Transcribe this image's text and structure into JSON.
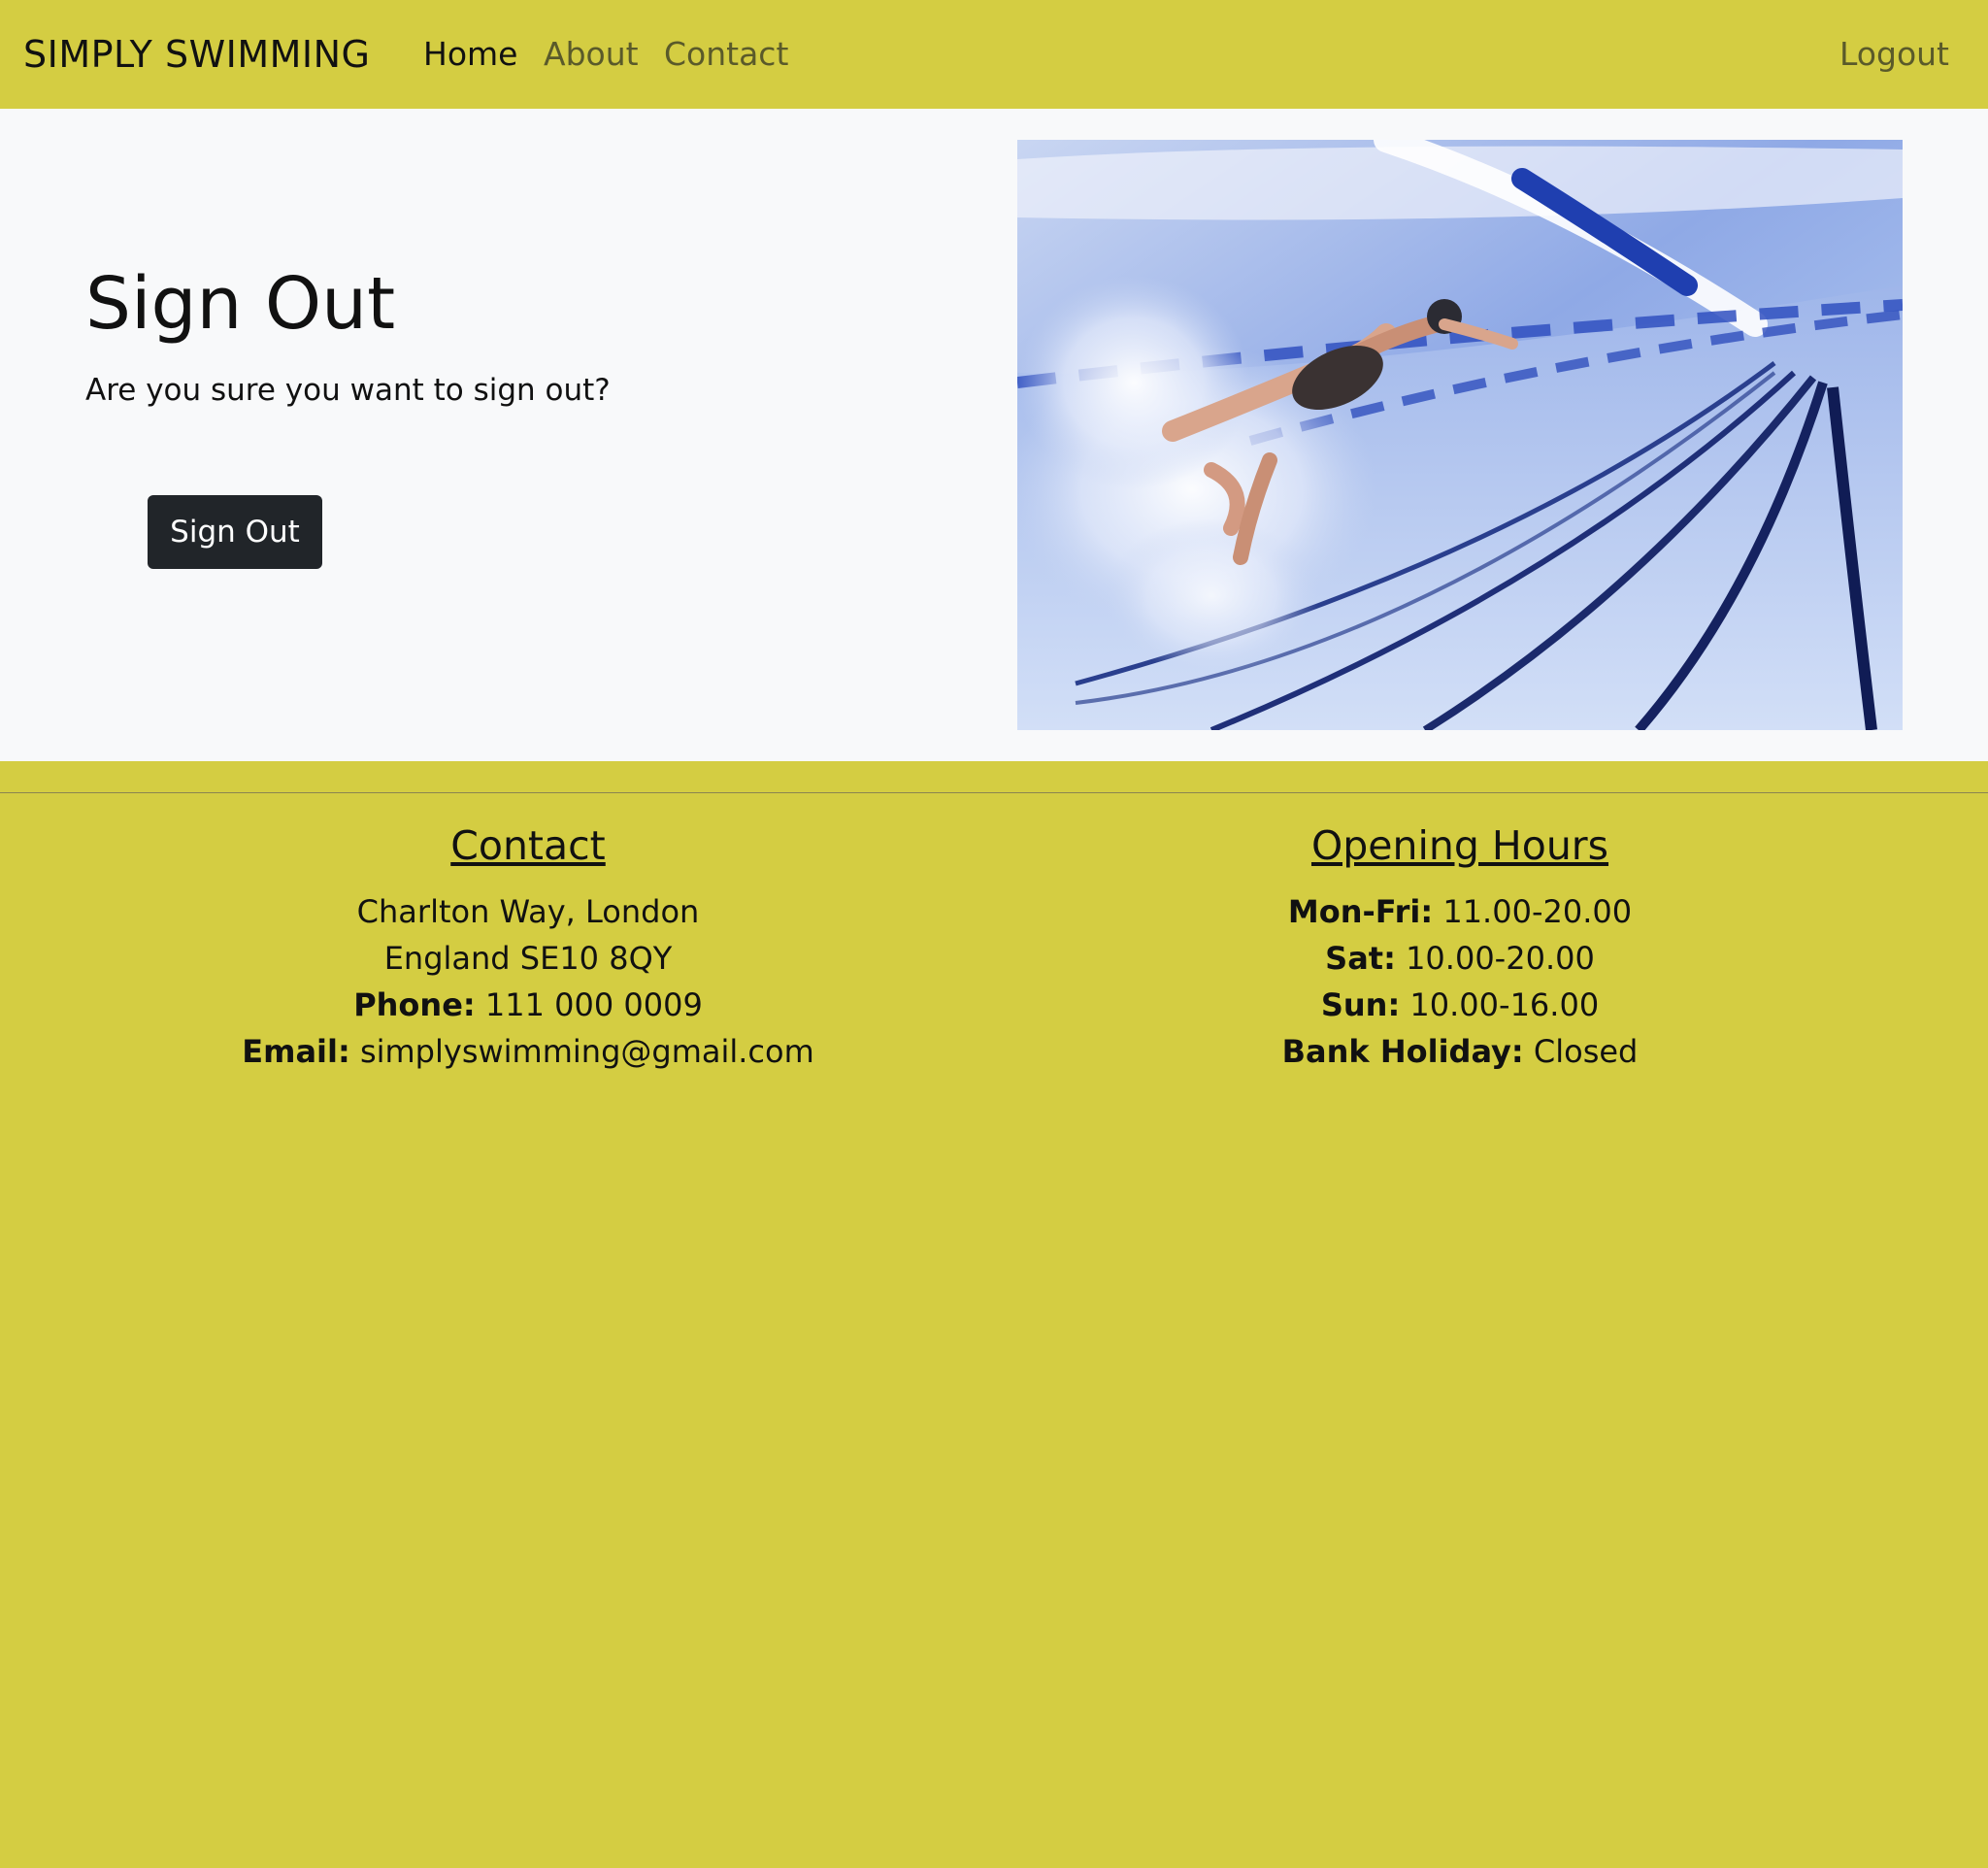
{
  "navbar": {
    "brand": "SIMPLY SWIMMING",
    "links": [
      {
        "label": "Home",
        "active": true
      },
      {
        "label": "About",
        "active": false
      },
      {
        "label": "Contact",
        "active": false
      }
    ],
    "logout_label": "Logout"
  },
  "hero": {
    "title": "Sign Out",
    "text": "Are you sure you want to sign out?",
    "button_label": "Sign Out"
  },
  "footer": {
    "contact": {
      "heading": "Contact",
      "address_line1": "Charlton Way, London",
      "address_line2": "England SE10 8QY",
      "phone_label": "Phone:",
      "phone_value": "111 000 0009",
      "email_label": "Email:",
      "email_value": "simplyswimming@gmail.com"
    },
    "hours": {
      "heading": "Opening Hours",
      "rows": [
        {
          "day": "Mon-Fri:",
          "time": "11.00-20.00"
        },
        {
          "day": "Sat:",
          "time": "10.00-20.00"
        },
        {
          "day": "Sun:",
          "time": "10.00-16.00"
        },
        {
          "day": "Bank Holiday:",
          "time": "Closed"
        }
      ]
    }
  },
  "colors": {
    "brand_yellow": "#d4cd42",
    "hero_bg": "#f8f9fa",
    "button_dark": "#212529"
  }
}
